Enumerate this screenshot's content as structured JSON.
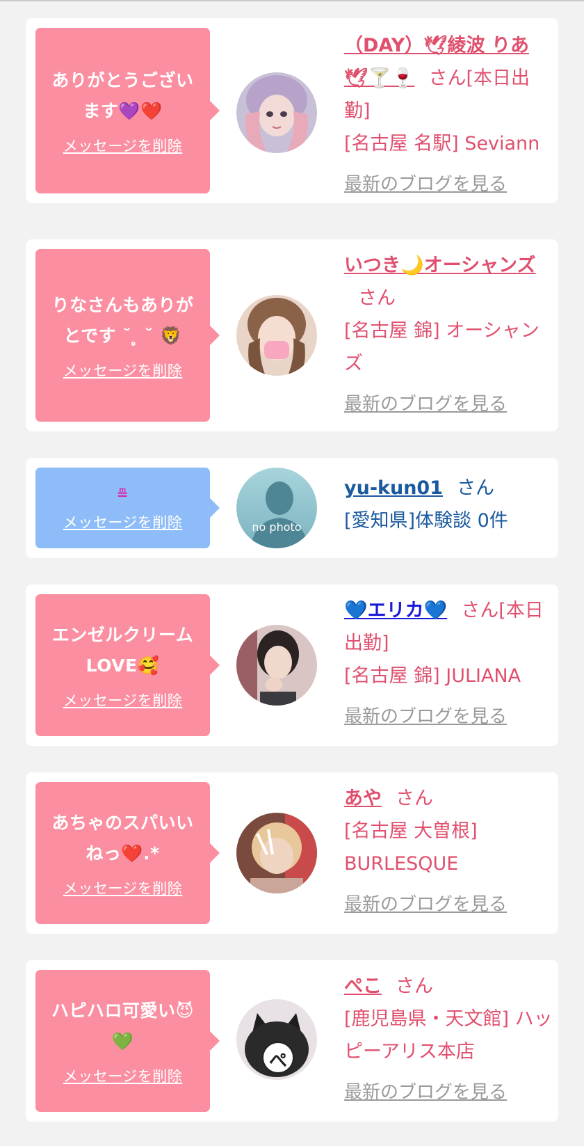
{
  "cards": [
    {
      "message": "ありがとうございます💜❤️",
      "delete_label": "メッセージを削除",
      "username": "（DAY）🕊綾波 りあ🕊🍸🍷",
      "honorific": "さん[本日出勤]",
      "shop": "[名古屋 名駅] Seviann",
      "blog_label": "最新のブログを見る"
    },
    {
      "message": "りなさんもありがとです ˘ ̥ ˘ 🦁",
      "delete_label": "メッセージを削除",
      "username": "いつき🌙オーシャンズ",
      "honorific": "さん",
      "shop": "[名古屋 錦] オーシャンズ",
      "blog_label": "最新のブログを見る"
    },
    {
      "message": "≞",
      "delete_label": "メッセージを削除",
      "username": "yu-kun01",
      "honorific": "さん",
      "review": "[愛知県]体験談 0件",
      "avatar_text": "no photo"
    },
    {
      "message": "エンゼルクリームLOVE🥰",
      "delete_label": "メッセージを削除",
      "username": "💙エリカ💙",
      "honorific": "さん[本日出勤]",
      "shop": "[名古屋 錦] JULIANA",
      "blog_label": "最新のブログを見る"
    },
    {
      "message": "あちゃのスパいいねっ❤️.*",
      "delete_label": "メッセージを削除",
      "username": "あや",
      "honorific": "さん",
      "shop": "[名古屋 大曽根] BURLESQUE",
      "blog_label": "最新のブログを見る"
    },
    {
      "message": "ハピハロ可愛い😈💚",
      "delete_label": "メッセージを削除",
      "username": "ぺこ",
      "honorific": "さん",
      "shop": "[鹿児島県・天文館] ハッピーアリス本店",
      "blog_label": "最新のブログを見る",
      "avatar_text": "ぺ"
    }
  ]
}
